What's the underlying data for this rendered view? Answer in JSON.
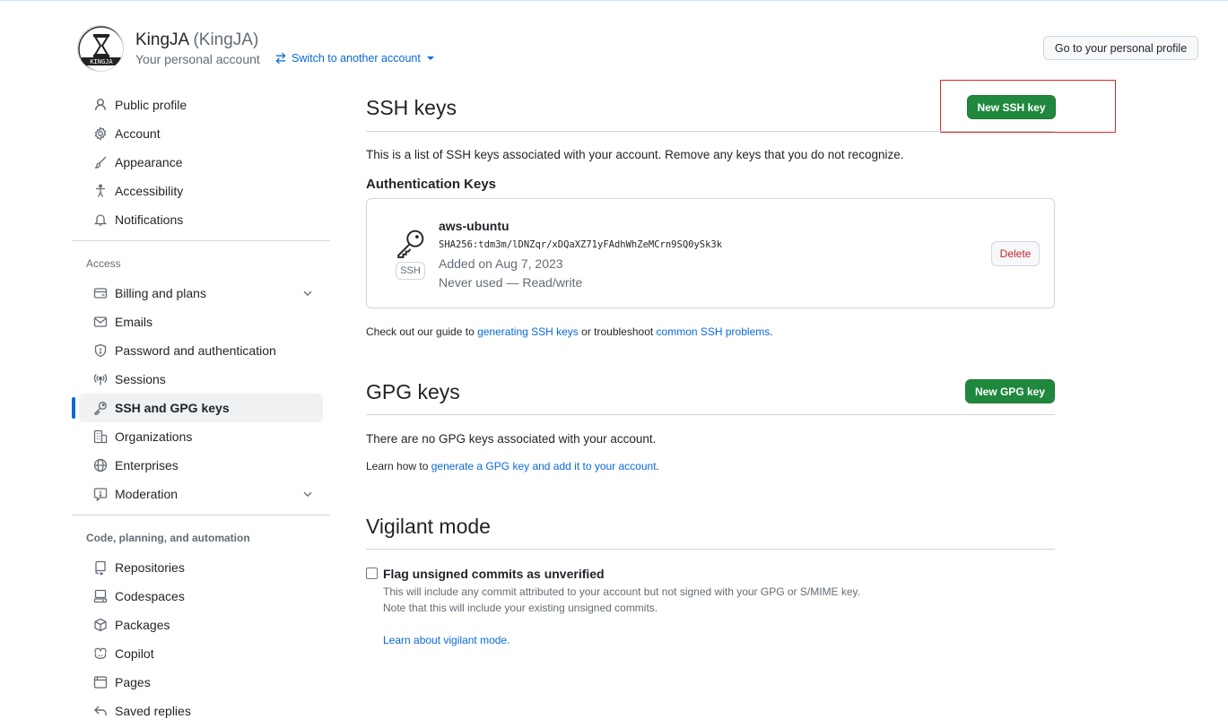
{
  "header": {
    "display_name": "KingJA",
    "login": "(KingJA)",
    "subtitle": "Your personal account",
    "switch_label": "Switch to another account",
    "profile_button": "Go to your personal profile",
    "avatar_text": "KINGJA"
  },
  "sidebar": {
    "top_items": [
      {
        "label": "Public profile",
        "icon": "person-icon"
      },
      {
        "label": "Account",
        "icon": "gear-icon"
      },
      {
        "label": "Appearance",
        "icon": "paintbrush-icon"
      },
      {
        "label": "Accessibility",
        "icon": "accessibility-icon"
      },
      {
        "label": "Notifications",
        "icon": "bell-icon"
      }
    ],
    "access_heading": "Access",
    "access_items": [
      {
        "label": "Billing and plans",
        "icon": "credit-card-icon",
        "expandable": true
      },
      {
        "label": "Emails",
        "icon": "mail-icon"
      },
      {
        "label": "Password and authentication",
        "icon": "shield-icon"
      },
      {
        "label": "Sessions",
        "icon": "broadcast-icon"
      },
      {
        "label": "SSH and GPG keys",
        "icon": "key-icon",
        "active": true
      },
      {
        "label": "Organizations",
        "icon": "organization-icon"
      },
      {
        "label": "Enterprises",
        "icon": "globe-icon"
      },
      {
        "label": "Moderation",
        "icon": "report-icon",
        "expandable": true
      }
    ],
    "code_heading": "Code, planning, and automation",
    "code_items": [
      {
        "label": "Repositories",
        "icon": "repo-icon"
      },
      {
        "label": "Codespaces",
        "icon": "codespaces-icon"
      },
      {
        "label": "Packages",
        "icon": "package-icon"
      },
      {
        "label": "Copilot",
        "icon": "copilot-icon"
      },
      {
        "label": "Pages",
        "icon": "browser-icon"
      },
      {
        "label": "Saved replies",
        "icon": "reply-icon"
      }
    ]
  },
  "ssh": {
    "title": "SSH keys",
    "new_button": "New SSH key",
    "description": "This is a list of SSH keys associated with your account. Remove any keys that you do not recognize.",
    "auth_heading": "Authentication Keys",
    "key": {
      "name": "aws-ubuntu",
      "fingerprint": "SHA256:tdm3m/lDNZqr/xDQaXZ71yFAdhWhZeMCrn9SQ0ySk3k",
      "badge": "SSH",
      "added": "Added on Aug 7, 2023",
      "usage": "Never used — Read/write",
      "delete_button": "Delete"
    },
    "guide_prefix": "Check out our guide to ",
    "guide_link1": "generating SSH keys",
    "guide_middle": " or troubleshoot ",
    "guide_link2": "common SSH problems",
    "guide_suffix": "."
  },
  "gpg": {
    "title": "GPG keys",
    "new_button": "New GPG key",
    "empty": "There are no GPG keys associated with your account.",
    "learn_prefix": "Learn how to ",
    "learn_link": "generate a GPG key and add it to your account",
    "learn_suffix": "."
  },
  "vigilant": {
    "title": "Vigilant mode",
    "checkbox_label": "Flag unsigned commits as unverified",
    "desc1": "This will include any commit attributed to your account but not signed with your GPG or S/MIME key.",
    "desc2": "Note that this will include your existing unsigned commits.",
    "learn_link": "Learn about vigilant mode",
    "learn_suffix": "."
  },
  "colors": {
    "primary_green": "#1f883d",
    "link_blue": "#0969da",
    "danger_red": "#cf222e",
    "highlight_red": "#e0262b"
  }
}
